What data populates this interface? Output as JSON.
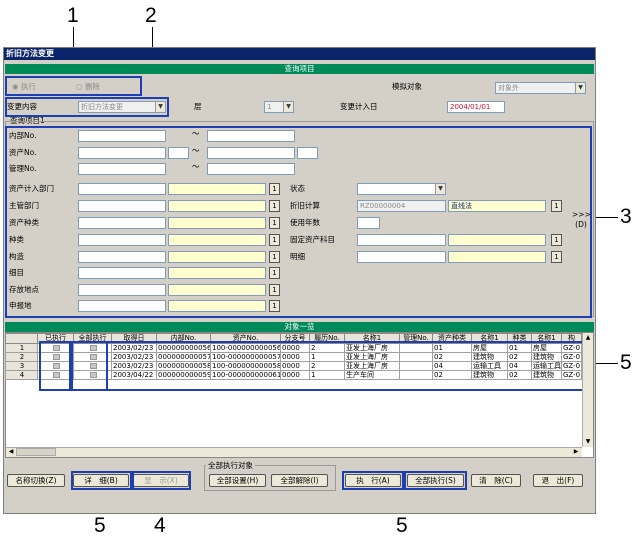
{
  "callouts": [
    "1",
    "2",
    "3",
    "4",
    "5",
    "5",
    "5"
  ],
  "window": {
    "title": "折旧方法变更"
  },
  "section_query": "查询项目",
  "mode": {
    "execute": "执行",
    "delete": "删除"
  },
  "sim_target": {
    "label": "模拟对象",
    "value": "对象外"
  },
  "change_content": {
    "label": "变更内容",
    "value": "折旧方法变更"
  },
  "layer": {
    "label": "层",
    "value": "1"
  },
  "change_date": {
    "label": "变更计入日",
    "value": "2004/01/01"
  },
  "group_label": "查询项目1",
  "fields": {
    "internal_no": "内部No.",
    "asset_no": "资产No.",
    "mgmt_no": "管理No.",
    "tilde": "～",
    "dept": "资产计入部门",
    "mgr_dept": "主管部门",
    "asset_kind": "资产种类",
    "category": "种类",
    "structure": "构造",
    "detail": "细目",
    "location": "存放地点",
    "report_loc": "申报地",
    "status": "状态",
    "depr_calc": "折旧计算",
    "depr_code": "RZ00000004",
    "depr_method": "直线法",
    "useful_life": "使用年数",
    "fixed_asset_subject": "固定资产科目",
    "breakdown": "明细",
    "expand": ">>>\n(D)"
  },
  "list": {
    "title": "对象一览",
    "headers": [
      "",
      "已执行",
      "全部执行",
      "取得日",
      "内部No.",
      "资产No.",
      "分支号",
      "履历No.",
      "名称1",
      "管理No.",
      "资产种类",
      "名称1",
      "种类",
      "名称1",
      "构"
    ],
    "rows": [
      [
        "1",
        "",
        "",
        "2003/02/23",
        "000000000056",
        "100-000000000056",
        "0000",
        "2",
        "亚发上海厂房",
        "",
        "01",
        "房屋",
        "01",
        "房屋",
        "GZ-0"
      ],
      [
        "2",
        "",
        "",
        "2003/02/23",
        "000000000057",
        "100-000000000057",
        "0000",
        "1",
        "亚发上海厂房",
        "",
        "02",
        "建筑物",
        "02",
        "建筑物",
        "GZ-0"
      ],
      [
        "3",
        "",
        "",
        "2003/02/23",
        "000000000058",
        "100-000000000058",
        "0000",
        "2",
        "亚发上海厂房",
        "",
        "04",
        "运输工具",
        "04",
        "运输工具",
        "GZ-0"
      ],
      [
        "4",
        "",
        "",
        "2003/04/22",
        "000000000059",
        "100-000000000061",
        "0000",
        "1",
        "生产车间",
        "",
        "02",
        "建筑物",
        "02",
        "建筑物",
        "GZ-0"
      ]
    ]
  },
  "footer": {
    "group_label": "全部执行对象",
    "name_toggle": "名称切换(Z)",
    "detail": "详　细(B)",
    "show": "显　示(X)",
    "select_all": "全部设置(H)",
    "clear_all": "全部解除(I)",
    "execute": "执　行(A)",
    "execute_all": "全部执行(S)",
    "clear": "清　除(C)",
    "exit": "退　出(F)"
  },
  "colors": {
    "title": "#0a246a",
    "section": "#008a5a",
    "highlight": "#1d3fb0",
    "date": "#d0102a"
  }
}
